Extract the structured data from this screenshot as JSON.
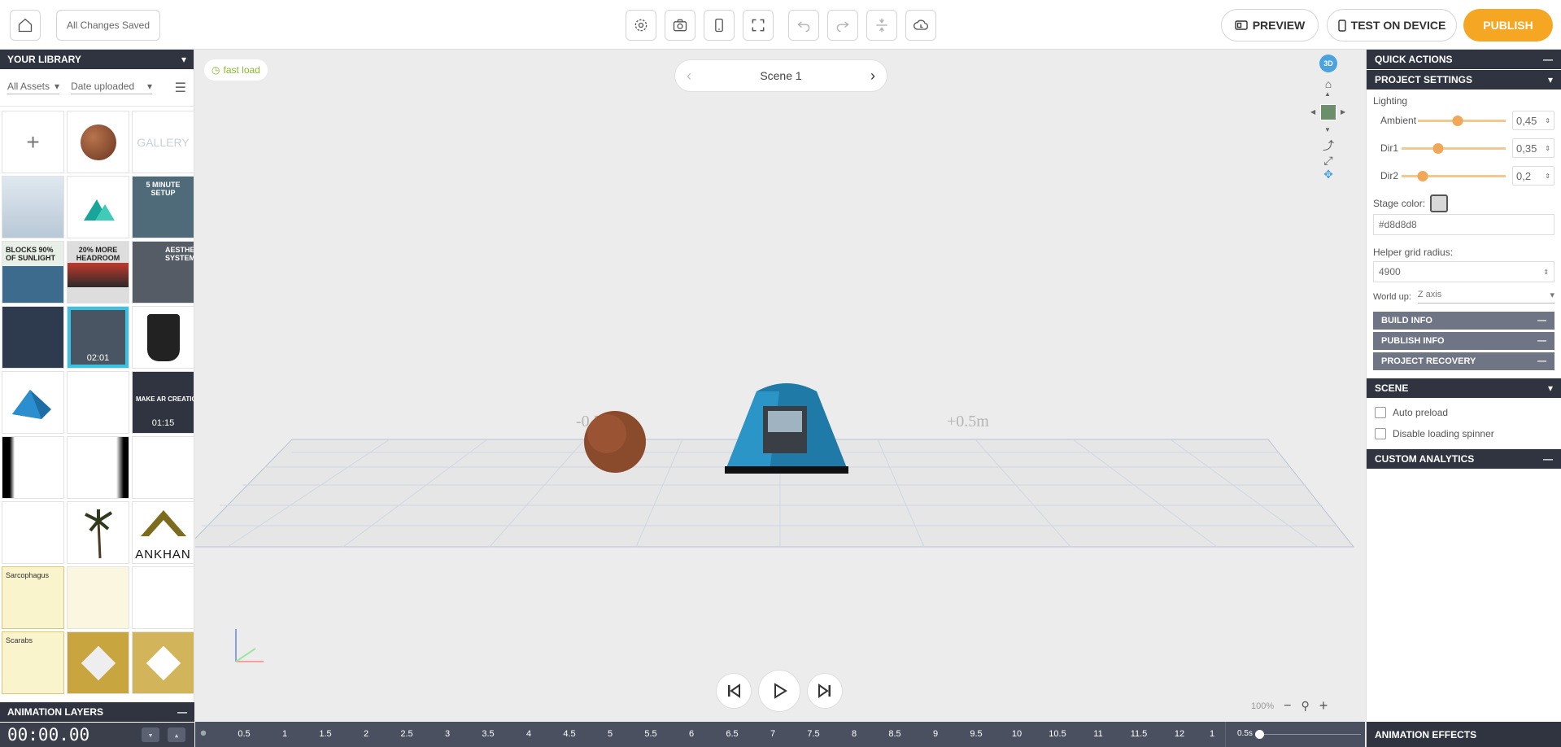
{
  "topbar": {
    "save_status": "All Changes Saved",
    "preview_label": "PREVIEW",
    "test_label": "TEST ON DEVICE",
    "publish_label": "PUBLISH",
    "accent_color": "#f5a623"
  },
  "library": {
    "title": "YOUR LIBRARY",
    "filter_assets": "All Assets",
    "filter_sort": "Date uploaded",
    "gallery_label": "GALLERY",
    "tile_captions": {
      "sunlight": "BLOCKS 90% OF SUNLIGHT",
      "headroom": "20% MORE HEADROOM",
      "aesthetic": "AESTHETIC SYSTEM",
      "setup": "5 MINUTE SETUP",
      "make_ar": "MAKE AR CREATION EA",
      "ankhan": "ANKHAN",
      "sarcophagus": "Sarcophagus",
      "scarabs": "Scarabs"
    },
    "durations": [
      "02:01",
      "01:15"
    ]
  },
  "animation_layers": {
    "title": "ANIMATION LAYERS",
    "timecode": "00:00.00"
  },
  "viewport": {
    "fast_load": "fast load",
    "scene_name": "Scene 1",
    "label_left": "-0.5m",
    "label_right": "+0.5m",
    "view_mode": "3D",
    "zoom": "100%"
  },
  "timeline": {
    "ticks": [
      "0.5",
      "1",
      "1.5",
      "2",
      "2.5",
      "3",
      "3.5",
      "4",
      "4.5",
      "5",
      "5.5",
      "6",
      "6.5",
      "7",
      "7.5",
      "8",
      "8.5",
      "9",
      "9.5",
      "10",
      "10.5",
      "11",
      "11.5",
      "12",
      "1"
    ],
    "step": "0.5s"
  },
  "right_panel": {
    "quick_actions": "QUICK ACTIONS",
    "project_settings": "PROJECT SETTINGS",
    "lighting": "Lighting",
    "sliders": [
      {
        "label": "Ambient",
        "value": "0,45",
        "fraction": 0.45
      },
      {
        "label": "Dir1",
        "value": "0,35",
        "fraction": 0.35
      },
      {
        "label": "Dir2",
        "value": "0,2",
        "fraction": 0.2
      }
    ],
    "stage_color_label": "Stage color:",
    "stage_color_value": "#d8d8d8",
    "helper_grid_label": "Helper grid radius:",
    "helper_grid_value": "4900",
    "world_up_label": "World up:",
    "world_up_value": "Z axis",
    "build_info": "BUILD INFO",
    "publish_info": "PUBLISH INFO",
    "project_recovery": "PROJECT RECOVERY",
    "scene_title": "SCENE",
    "auto_preload": "Auto preload",
    "disable_spinner": "Disable loading spinner",
    "custom_analytics": "CUSTOM ANALYTICS",
    "animation_effects": "ANIMATION EFFECTS"
  }
}
